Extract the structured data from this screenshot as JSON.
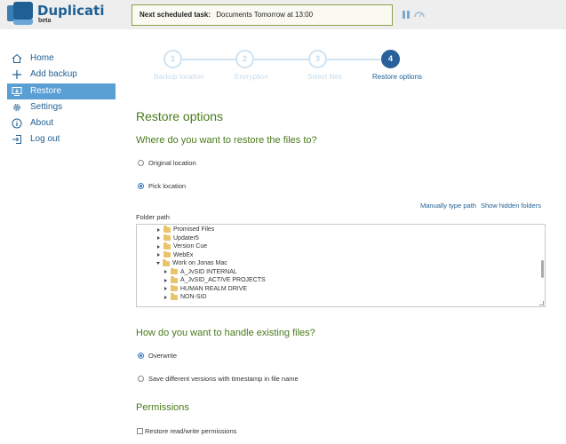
{
  "app": {
    "title": "Duplicati",
    "subtitle": "beta"
  },
  "status": {
    "label": "Next scheduled task:",
    "value": "Documents Tomorrow at 13:00"
  },
  "sidebar": {
    "items": [
      {
        "label": "Home",
        "icon": "home-icon"
      },
      {
        "label": "Add backup",
        "icon": "plus-icon"
      },
      {
        "label": "Restore",
        "icon": "restore-icon",
        "active": true
      },
      {
        "label": "Settings",
        "icon": "gear-icon"
      },
      {
        "label": "About",
        "icon": "info-icon"
      },
      {
        "label": "Log out",
        "icon": "logout-icon"
      }
    ]
  },
  "wizard": {
    "steps": [
      {
        "number": "1",
        "label": "Backup location"
      },
      {
        "number": "2",
        "label": "Encryption"
      },
      {
        "number": "3",
        "label": "Select files"
      },
      {
        "number": "4",
        "label": "Restore options",
        "active": true
      }
    ]
  },
  "restore": {
    "title": "Restore options",
    "where_heading": "Where do you want to restore the files to?",
    "options": {
      "original": "Original location",
      "pick": "Pick location"
    },
    "selected_option": "pick",
    "manual_path_link": "Manually type path",
    "hidden_folders_link": "Show hidden folders",
    "folder_path_label": "Folder path",
    "folders": [
      {
        "name": "Promised Files",
        "level": 0,
        "expanded": false
      },
      {
        "name": "Updater5",
        "level": 0,
        "expanded": false
      },
      {
        "name": "Version Cue",
        "level": 0,
        "expanded": false
      },
      {
        "name": "WebEx",
        "level": 0,
        "expanded": false
      },
      {
        "name": "Work on Jonas Mac",
        "level": 0,
        "expanded": true
      },
      {
        "name": "A_JvSID INTERNAL",
        "level": 1,
        "expanded": false
      },
      {
        "name": "A_JvSID_ACTIVE PROJECTS",
        "level": 1,
        "expanded": false
      },
      {
        "name": "HUMAN REALM DRIVE",
        "level": 1,
        "expanded": false
      },
      {
        "name": "NON-SID",
        "level": 1,
        "expanded": false
      }
    ],
    "existing_heading": "How do you want to handle existing files?",
    "existing_options": {
      "overwrite": "Overwrite",
      "versions": "Save different versions with timestamp in file name"
    },
    "existing_selected": "overwrite",
    "permissions_heading": "Permissions",
    "permissions_checkbox": "Restore read/write permissions",
    "permissions_checked": false
  },
  "colors": {
    "brand": "#1f5f93",
    "accent_green": "#4a7a1a",
    "nav_active": "#5a9fd4"
  }
}
